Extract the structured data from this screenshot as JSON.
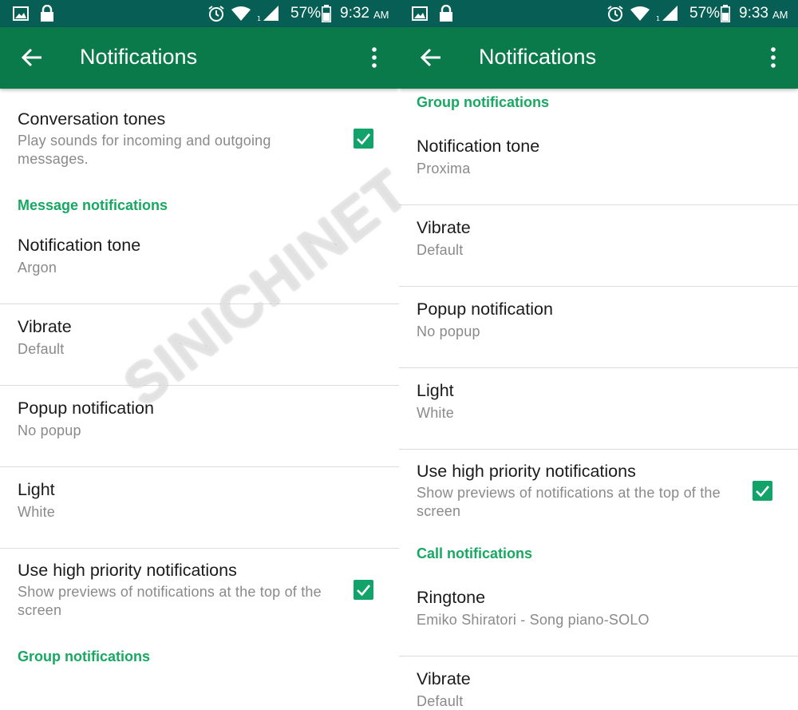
{
  "watermark": "SINICHINET",
  "colors": {
    "status_bar": "#075e54",
    "app_bar": "#0b7a4b",
    "section_header": "#17a862",
    "checkbox": "#12a36a"
  },
  "panels": [
    {
      "status": {
        "battery": "57%",
        "time": "9:32",
        "ampm": "AM"
      },
      "app_bar": {
        "title": "Notifications",
        "back_icon": "arrow-back-icon",
        "menu_icon": "more-vert-icon"
      },
      "items": [
        {
          "kind": "row",
          "title": "Conversation tones",
          "subtitle": "Play sounds for incoming and outgoing messages.",
          "checkbox": true,
          "checked": true
        },
        {
          "kind": "header",
          "label": "Message notifications"
        },
        {
          "kind": "row",
          "title": "Notification tone",
          "subtitle": "Argon"
        },
        {
          "kind": "divider"
        },
        {
          "kind": "row",
          "title": "Vibrate",
          "subtitle": "Default"
        },
        {
          "kind": "divider"
        },
        {
          "kind": "row",
          "title": "Popup notification",
          "subtitle": "No popup"
        },
        {
          "kind": "divider"
        },
        {
          "kind": "row",
          "title": "Light",
          "subtitle": "White"
        },
        {
          "kind": "divider"
        },
        {
          "kind": "row",
          "title": "Use high priority notifications",
          "subtitle": "Show previews of notifications at the top of the screen",
          "checkbox": true,
          "checked": true
        },
        {
          "kind": "header",
          "label": "Group notifications"
        }
      ]
    },
    {
      "status": {
        "battery": "57%",
        "time": "9:33",
        "ampm": "AM"
      },
      "app_bar": {
        "title": "Notifications",
        "back_icon": "arrow-back-icon",
        "menu_icon": "more-vert-icon"
      },
      "items": [
        {
          "kind": "header",
          "label": "Group notifications"
        },
        {
          "kind": "row",
          "title": "Notification tone",
          "subtitle": "Proxima"
        },
        {
          "kind": "divider"
        },
        {
          "kind": "row",
          "title": "Vibrate",
          "subtitle": "Default"
        },
        {
          "kind": "divider"
        },
        {
          "kind": "row",
          "title": "Popup notification",
          "subtitle": "No popup"
        },
        {
          "kind": "divider"
        },
        {
          "kind": "row",
          "title": "Light",
          "subtitle": "White"
        },
        {
          "kind": "divider"
        },
        {
          "kind": "row",
          "title": "Use high priority notifications",
          "subtitle": "Show previews of notifications at the top of the screen",
          "checkbox": true,
          "checked": true
        },
        {
          "kind": "header",
          "label": "Call notifications"
        },
        {
          "kind": "row",
          "title": "Ringtone",
          "subtitle": "Emiko Shiratori - Song piano-SOLO"
        },
        {
          "kind": "divider"
        },
        {
          "kind": "row",
          "title": "Vibrate",
          "subtitle": "Default"
        }
      ]
    }
  ]
}
